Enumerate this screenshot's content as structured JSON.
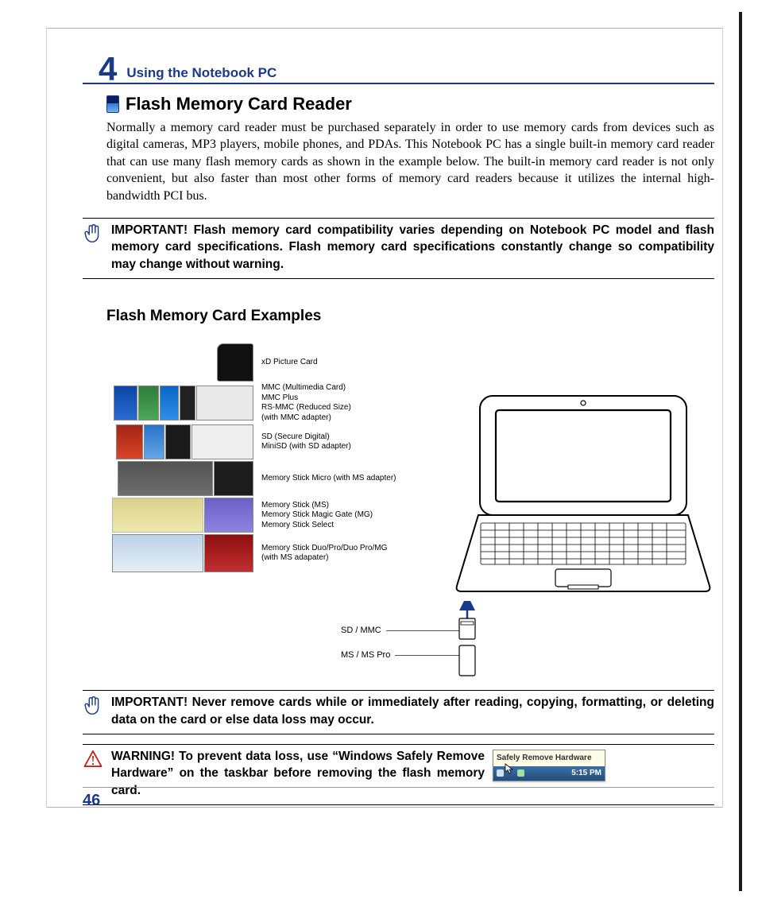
{
  "chapter": {
    "num": "4",
    "title": "Using the Notebook PC"
  },
  "section1": {
    "title": "Flash Memory Card Reader",
    "body": "Normally a memory card reader must be purchased separately in order to use memory cards from devices such as digital cameras, MP3 players, mobile phones, and PDAs. This Notebook PC has a single built-in memory card reader that can use many flash memory cards as shown in the example below. The built-in memory card reader is not only convenient, but also faster than most other forms of memory card readers because it utilizes the internal high-bandwidth PCI bus."
  },
  "important1": "IMPORTANT! Flash memory card compatibility varies depending on Notebook PC model and flash memory card specifications. Flash memory card specifications constantly change so compatibility may change without warning.",
  "section2": {
    "title": "Flash Memory Card Examples"
  },
  "cards": {
    "xd": "xD Picture Card",
    "mmc": "MMC (Multimedia Card)\nMMC Plus\nRS-MMC (Reduced Size)\n(with MMC adapter)",
    "sd": "SD (Secure Digital)\nMiniSD (with SD adapter)",
    "ms_micro": "Memory Stick Micro (with MS adapter)",
    "ms_std": "Memory Stick (MS)\nMemory Stick Magic Gate (MG)\nMemory Stick Select",
    "ms_duo": "Memory Stick Duo/Pro/Duo Pro/MG\n(with MS adapater)"
  },
  "slots": {
    "sd_mmc": "SD / MMC",
    "ms_pro": "MS / MS Pro"
  },
  "important2": "IMPORTANT!  Never remove cards while or immediately after reading, copying, formatting, or deleting data on the card or else data loss may occur.",
  "warning": "WARNING! To prevent data loss, use “Windows Safely Remove Hardware” on the taskbar before removing the flash memory card.",
  "safely_remove": {
    "tooltip": "Safely Remove Hardware",
    "time": "5:15 PM"
  },
  "page_number": "46"
}
